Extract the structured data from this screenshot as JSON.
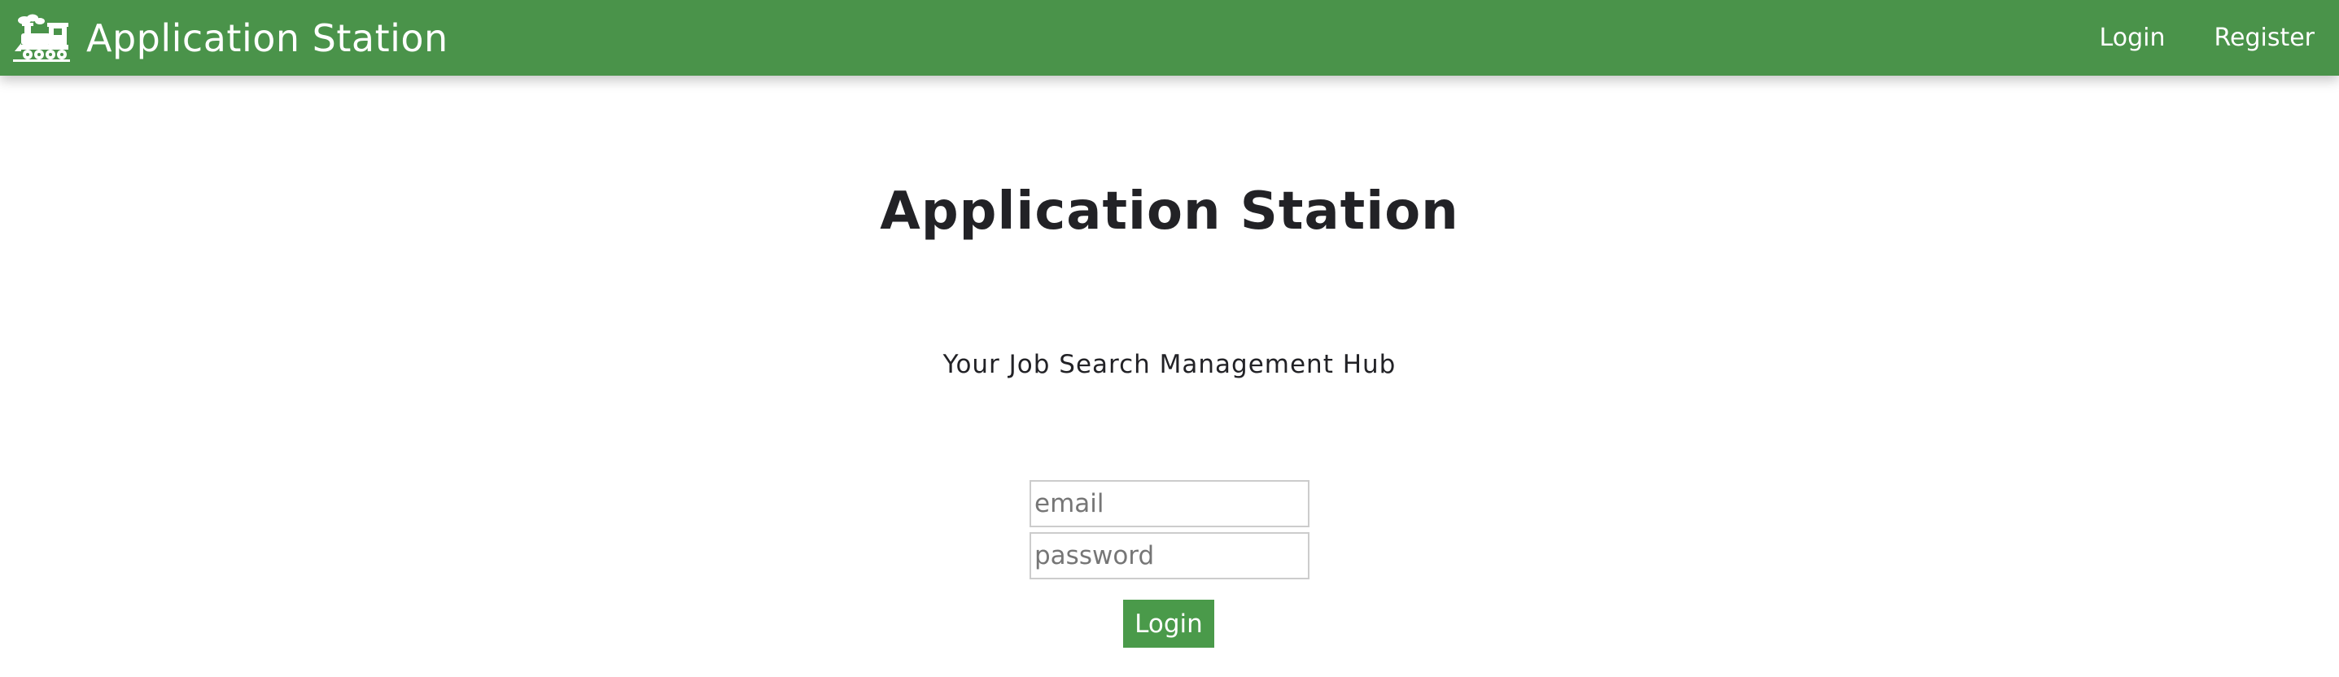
{
  "navbar": {
    "brand_title": "Application Station",
    "logo_icon": "train-icon",
    "links": {
      "login": "Login",
      "register": "Register"
    },
    "background_color": "#4a934a"
  },
  "hero": {
    "title": "Application Station",
    "subtitle": "Your Job Search Management Hub"
  },
  "login_form": {
    "email_placeholder": "email",
    "email_value": "",
    "password_placeholder": "password",
    "password_value": "",
    "submit_label": "Login",
    "button_color": "#4a9a4a"
  }
}
